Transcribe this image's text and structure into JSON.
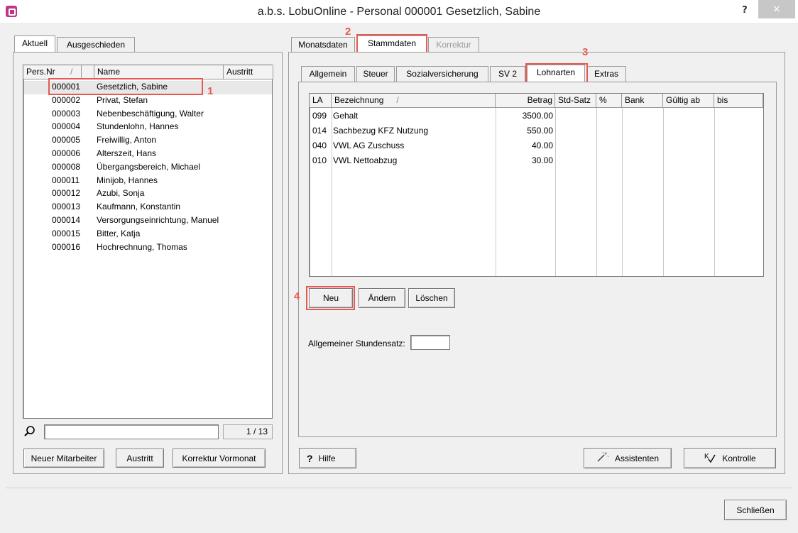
{
  "window": {
    "title": "a.b.s. LobuOnline - Personal 000001 Gesetzlich, Sabine",
    "help": "?",
    "close": "×"
  },
  "left": {
    "tabs": [
      "Aktuell",
      "Ausgeschieden"
    ],
    "columns": [
      "Pers.Nr",
      "Name",
      "Austritt"
    ],
    "sort_marker": "/",
    "employees": [
      {
        "nr": "000001",
        "name": "Gesetzlich, Sabine"
      },
      {
        "nr": "000002",
        "name": "Privat, Stefan"
      },
      {
        "nr": "000003",
        "name": "Nebenbeschäftigung, Walter"
      },
      {
        "nr": "000004",
        "name": "Stundenlohn, Hannes"
      },
      {
        "nr": "000005",
        "name": "Freiwillig, Anton"
      },
      {
        "nr": "000006",
        "name": "Alterszeit, Hans"
      },
      {
        "nr": "000008",
        "name": "Übergangsbereich, Michael"
      },
      {
        "nr": "000011",
        "name": "Minijob, Hannes"
      },
      {
        "nr": "000012",
        "name": "Azubi, Sonja"
      },
      {
        "nr": "000013",
        "name": "Kaufmann, Konstantin"
      },
      {
        "nr": "000014",
        "name": "Versorgungseinrichtung, Manuel"
      },
      {
        "nr": "000015",
        "name": "Bitter, Katja"
      },
      {
        "nr": "000016",
        "name": "Hochrechnung, Thomas"
      }
    ],
    "search_value": "",
    "count": "1 / 13",
    "buttons": {
      "new": "Neuer Mitarbeiter",
      "exit": "Austritt",
      "correction": "Korrektur Vormonat"
    }
  },
  "right": {
    "top_tabs": [
      "Monatsdaten",
      "Stammdaten",
      "Korrektur"
    ],
    "sub_tabs": [
      "Allgemein",
      "Steuer",
      "Sozialversicherung",
      "SV 2",
      "Lohnarten",
      "Extras"
    ],
    "table": {
      "columns": [
        "LA",
        "Bezeichnung",
        "Betrag",
        "Std-Satz",
        "%",
        "Bank",
        "Gültig ab",
        "bis"
      ],
      "sort_marker": "/",
      "rows": [
        {
          "la": "099",
          "bez": "Gehalt",
          "betrag": "3500.00"
        },
        {
          "la": "014",
          "bez": "Sachbezug KFZ Nutzung",
          "betrag": "550.00"
        },
        {
          "la": "040",
          "bez": "VWL AG Zuschuss",
          "betrag": "40.00"
        },
        {
          "la": "010",
          "bez": "VWL Nettoabzug",
          "betrag": "30.00"
        }
      ]
    },
    "buttons": {
      "new": "Neu",
      "edit": "Ändern",
      "delete": "Löschen"
    },
    "rate_label": "Allgemeiner Stundensatz:",
    "rate_value": "",
    "help_button": "Hilfe",
    "help_icon_text": "?",
    "assistant_button": "Assistenten",
    "control_button": "Kontrolle"
  },
  "footer": {
    "close_button": "Schließen"
  },
  "annotations": [
    "1",
    "2",
    "3",
    "4"
  ],
  "colors": {
    "highlight": "#e85a50",
    "selection": "#e8e8e8",
    "brand": "#c2348a"
  }
}
